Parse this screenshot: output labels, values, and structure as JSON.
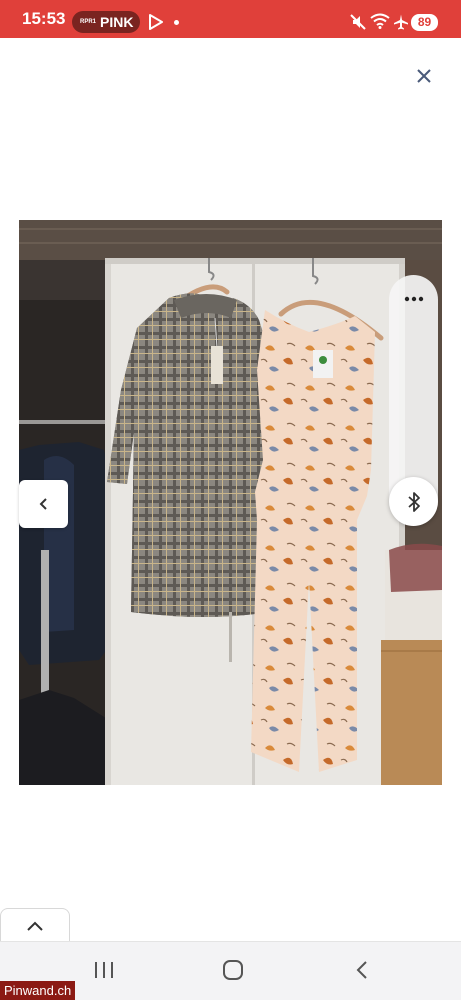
{
  "status_bar": {
    "time": "15:53",
    "radio_brand": "RPR1",
    "radio_name": "PINK",
    "battery": "89",
    "background_color": "#e0403a"
  },
  "icons": {
    "close": "close-icon",
    "previous": "chevron-left-icon",
    "more": "more-horizontal-icon",
    "bluetooth": "bluetooth-icon",
    "expand": "chevron-up-icon"
  },
  "photo": {
    "subject": "two dresses on hangers"
  },
  "watermark": "Pinwand.ch"
}
